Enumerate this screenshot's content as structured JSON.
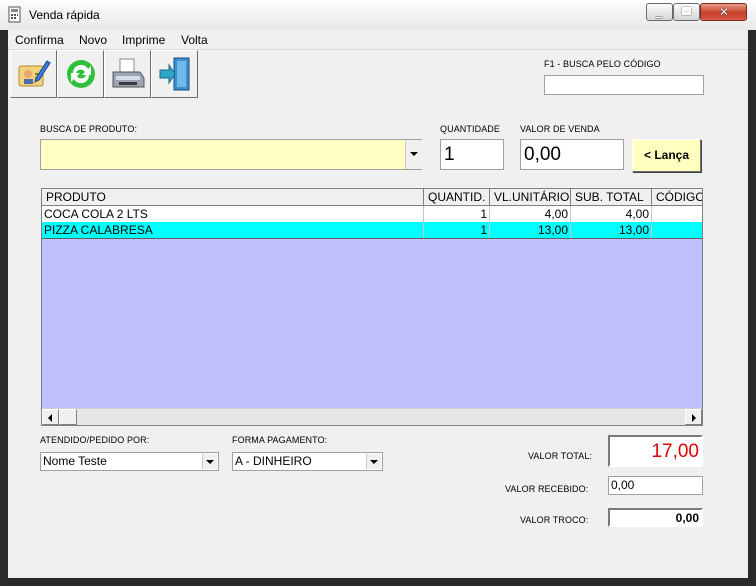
{
  "window": {
    "title": "Venda rápida"
  },
  "menu": [
    "Confirma",
    "Novo",
    "Imprime",
    "Volta"
  ],
  "toolbar": {
    "buttons": [
      "edit-icon",
      "refresh-icon",
      "printer-icon",
      "exit-door-icon"
    ]
  },
  "search_code": {
    "label": "F1 - BUSCA PELO CÓDIGO",
    "value": ""
  },
  "product_search": {
    "label": "BUSCA DE PRODUTO:",
    "value": ""
  },
  "quantity": {
    "label": "QUANTIDADE",
    "value": "1"
  },
  "sale_value": {
    "label": "VALOR DE VENDA",
    "value": "0,00"
  },
  "launch_button": {
    "label": "< Lança"
  },
  "grid": {
    "columns": [
      "PRODUTO",
      "QUANTID.",
      "VL.UNITÁRIO",
      "SUB. TOTAL",
      "CÓDIGO"
    ],
    "rows": [
      {
        "produto": "COCA COLA 2 LTS",
        "quantid": "1",
        "vl_unitario": "4,00",
        "sub_total": "4,00",
        "codigo": ""
      },
      {
        "produto": "PIZZA CALABRESA",
        "quantid": "1",
        "vl_unitario": "13,00",
        "sub_total": "13,00",
        "codigo": ""
      }
    ],
    "selected_row_color": "#00ffff",
    "background_color": "#c0c0ff"
  },
  "attended_by": {
    "label": "ATENDIDO/PEDIDO POR:",
    "value": "Nome Teste"
  },
  "payment": {
    "label": "FORMA PAGAMENTO:",
    "value": "A - DINHEIRO"
  },
  "totals": {
    "total_label": "VALOR TOTAL:",
    "total_value": "17,00",
    "total_color": "#dd0000",
    "received_label": "VALOR RECEBIDO:",
    "received_value": "0,00",
    "change_label": "VALOR TROCO:",
    "change_value": "0,00"
  }
}
